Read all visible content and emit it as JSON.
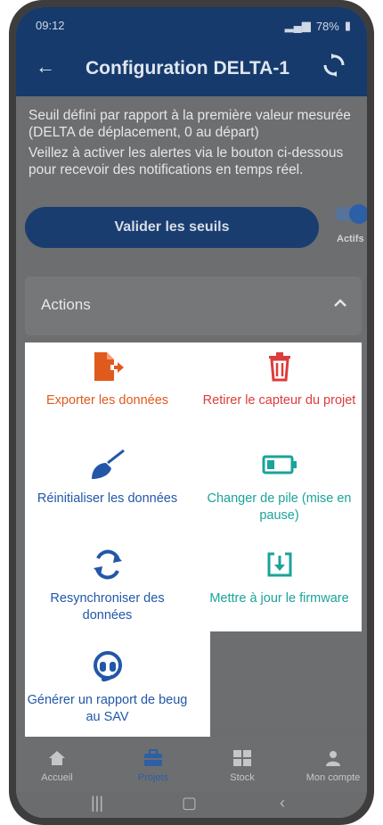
{
  "status": {
    "time": "09:12",
    "battery": "78%"
  },
  "header": {
    "title": "Configuration DELTA-1"
  },
  "info": {
    "paragraph1": "Seuil défini par rapport à la première valeur mesurée (DELTA de déplacement, 0 au départ)",
    "paragraph2": "Veillez à activer les alertes via le bouton ci-dessous pour recevoir des notifications en temps réel."
  },
  "validate_button": "Valider les seuils",
  "toggle": {
    "label": "Actifs",
    "on": true
  },
  "actions": {
    "title": "Actions"
  },
  "menu": {
    "export": "Exporter les données",
    "remove": "Retirer le capteur du projet",
    "reset": "Réinitialiser les données",
    "battery": "Changer de pile (mise en pause)",
    "resync": "Resynchroniser des données",
    "firmware": "Mettre à jour le firmware",
    "report": "Générer un rapport de beug au SAV"
  },
  "nav": {
    "home": "Accueil",
    "projects": "Projets",
    "stock": "Stock",
    "account": "Mon compte",
    "active": "Projets"
  },
  "colors": {
    "header": "#163a6b",
    "orange": "#e05a1e",
    "red": "#de3b3b",
    "blue": "#2257a8",
    "teal": "#1aa39a"
  }
}
